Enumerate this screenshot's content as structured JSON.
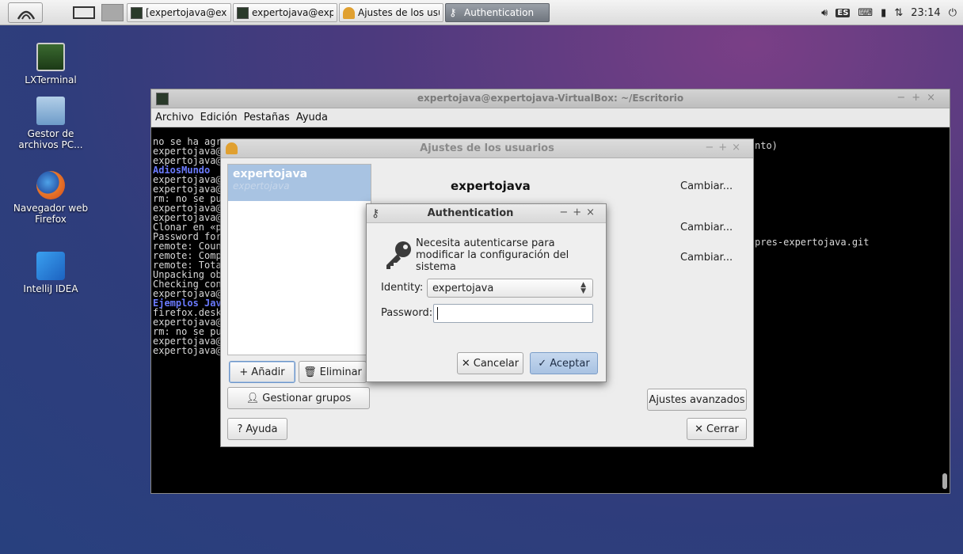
{
  "taskbar": {
    "tasks": [
      {
        "label": "[expertojava@ex..."
      },
      {
        "label": "expertojava@exp..."
      },
      {
        "label": "Ajustes de los usu..."
      },
      {
        "label": "Authentication"
      }
    ],
    "tray": {
      "keyboard_layout": "ES",
      "clock": "23:14"
    }
  },
  "desktop": {
    "icons": [
      {
        "label": "LXTerminal"
      },
      {
        "label": "Gestor de archivos PC..."
      },
      {
        "label": "Navegador web Firefox"
      },
      {
        "label": "IntelliJ IDEA"
      }
    ]
  },
  "terminal": {
    "title": "expertojava@expertojava-VirtualBox: ~/Escritorio",
    "menu": [
      "Archivo",
      "Edición",
      "Pestañas",
      "Ayuda"
    ],
    "lines": [
      "no se ha agr",
      "expertojava@",
      "expertojava@",
      "AdiosMundo",
      "expertojava@",
      "expertojava@",
      "rm: no se pu",
      "expertojava@",
      "expertojava@",
      "Clonar en «p",
      "Password for",
      "remote: Coun",
      "remote: Comp",
      "remote: Tota",
      "Unpacking ob",
      "Checking con",
      "expertojava@",
      "Ejemplos Jav",
      "firefox.desk",
      "expertojava@",
      "rm: no se pu",
      "expertojava@",
      "expertojava@"
    ],
    "right_fragment_1": "nto)",
    "right_fragment_2": "pres-expertojava.git"
  },
  "users_window": {
    "title": "Ajustes de los usuarios",
    "selected_user": {
      "name": "expertojava",
      "login": "expertojava"
    },
    "header_name": "expertojava",
    "change_labels": [
      "Cambiar...",
      "Cambiar...",
      "Cambiar..."
    ],
    "add_label": "Añadir",
    "delete_label": "Eliminar",
    "groups_label": "Gestionar grupos",
    "advanced_label": "Ajustes avanzados",
    "help_label": "Ayuda",
    "close_label": "Cerrar"
  },
  "auth_dialog": {
    "title": "Authentication",
    "message": "Necesita autenticarse para modificar la configuración del sistema",
    "identity_label": "Identity:",
    "identity_value": "expertojava",
    "password_label": "Password:",
    "password_value": "",
    "cancel_label": "Cancelar",
    "accept_label": "Aceptar"
  }
}
